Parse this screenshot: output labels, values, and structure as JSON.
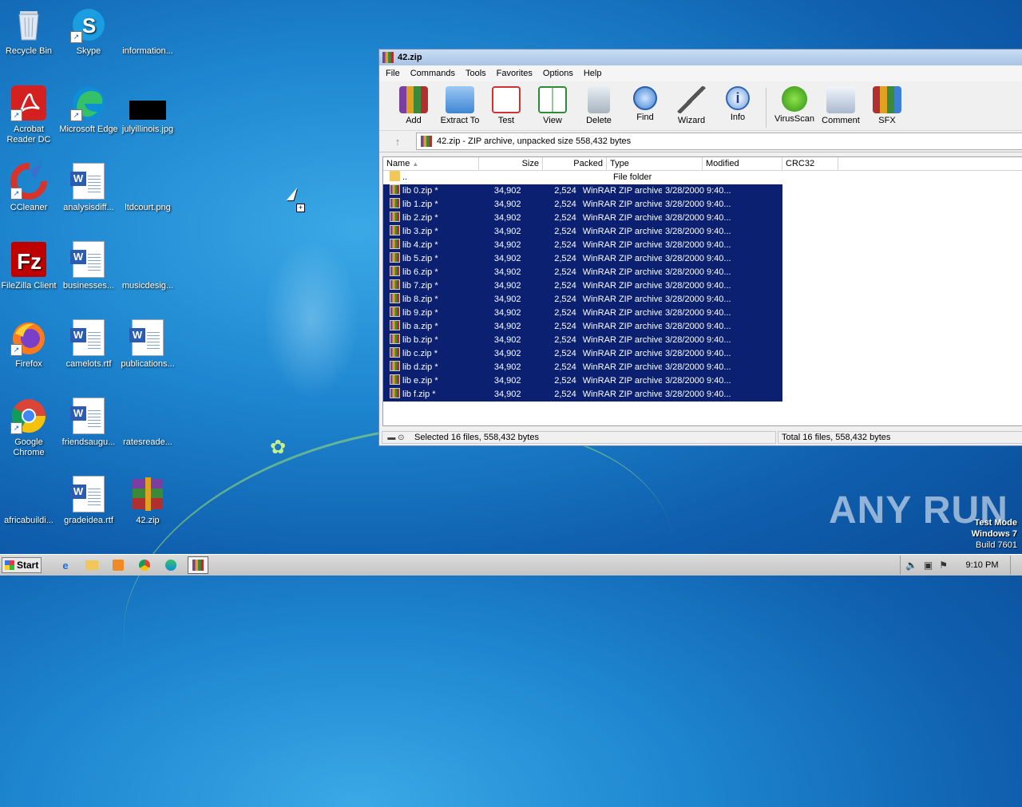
{
  "desktop": {
    "icons": [
      {
        "label": "Recycle Bin"
      },
      {
        "label": "Skype"
      },
      {
        "label": "information..."
      },
      {
        "label": "Acrobat Reader DC"
      },
      {
        "label": "Microsoft Edge"
      },
      {
        "label": "julyillinois.jpg"
      },
      {
        "label": "CCleaner"
      },
      {
        "label": "analysisdiff..."
      },
      {
        "label": "ltdcourt.png"
      },
      {
        "label": "FileZilla Client"
      },
      {
        "label": "businesses..."
      },
      {
        "label": "musicdesig..."
      },
      {
        "label": "Firefox"
      },
      {
        "label": "camelots.rtf"
      },
      {
        "label": "publications..."
      },
      {
        "label": "Google Chrome"
      },
      {
        "label": "friendsaugu..."
      },
      {
        "label": "ratesreade..."
      },
      {
        "label": "africabuildi..."
      },
      {
        "label": "gradeidea.rtf"
      },
      {
        "label": "42.zip"
      }
    ]
  },
  "window": {
    "title": "42.zip",
    "menu": [
      "File",
      "Commands",
      "Tools",
      "Favorites",
      "Options",
      "Help"
    ],
    "toolbar": [
      "Add",
      "Extract To",
      "Test",
      "View",
      "Delete",
      "Find",
      "Wizard",
      "Info",
      "VirusScan",
      "Comment",
      "SFX"
    ],
    "address": "42.zip - ZIP archive, unpacked size 558,432 bytes",
    "up_arrow": "↑",
    "columns": {
      "name": "Name",
      "size": "Size",
      "packed": "Packed",
      "type": "Type",
      "modified": "Modified",
      "crc": "CRC32"
    },
    "parent_row": {
      "name": "..",
      "type": "File folder"
    },
    "rows": [
      {
        "name": "lib 0.zip *",
        "size": "34,902",
        "packed": "2,524",
        "type": "WinRAR ZIP archive",
        "modified": "3/28/2000 9:40..."
      },
      {
        "name": "lib 1.zip *",
        "size": "34,902",
        "packed": "2,524",
        "type": "WinRAR ZIP archive",
        "modified": "3/28/2000 9:40..."
      },
      {
        "name": "lib 2.zip *",
        "size": "34,902",
        "packed": "2,524",
        "type": "WinRAR ZIP archive",
        "modified": "3/28/2000 9:40..."
      },
      {
        "name": "lib 3.zip *",
        "size": "34,902",
        "packed": "2,524",
        "type": "WinRAR ZIP archive",
        "modified": "3/28/2000 9:40..."
      },
      {
        "name": "lib 4.zip *",
        "size": "34,902",
        "packed": "2,524",
        "type": "WinRAR ZIP archive",
        "modified": "3/28/2000 9:40..."
      },
      {
        "name": "lib 5.zip *",
        "size": "34,902",
        "packed": "2,524",
        "type": "WinRAR ZIP archive",
        "modified": "3/28/2000 9:40..."
      },
      {
        "name": "lib 6.zip *",
        "size": "34,902",
        "packed": "2,524",
        "type": "WinRAR ZIP archive",
        "modified": "3/28/2000 9:40..."
      },
      {
        "name": "lib 7.zip *",
        "size": "34,902",
        "packed": "2,524",
        "type": "WinRAR ZIP archive",
        "modified": "3/28/2000 9:40..."
      },
      {
        "name": "lib 8.zip *",
        "size": "34,902",
        "packed": "2,524",
        "type": "WinRAR ZIP archive",
        "modified": "3/28/2000 9:40..."
      },
      {
        "name": "lib 9.zip *",
        "size": "34,902",
        "packed": "2,524",
        "type": "WinRAR ZIP archive",
        "modified": "3/28/2000 9:40..."
      },
      {
        "name": "lib a.zip *",
        "size": "34,902",
        "packed": "2,524",
        "type": "WinRAR ZIP archive",
        "modified": "3/28/2000 9:40..."
      },
      {
        "name": "lib b.zip *",
        "size": "34,902",
        "packed": "2,524",
        "type": "WinRAR ZIP archive",
        "modified": "3/28/2000 9:40..."
      },
      {
        "name": "lib c.zip *",
        "size": "34,902",
        "packed": "2,524",
        "type": "WinRAR ZIP archive",
        "modified": "3/28/2000 9:40..."
      },
      {
        "name": "lib d.zip *",
        "size": "34,902",
        "packed": "2,524",
        "type": "WinRAR ZIP archive",
        "modified": "3/28/2000 9:40..."
      },
      {
        "name": "lib e.zip *",
        "size": "34,902",
        "packed": "2,524",
        "type": "WinRAR ZIP archive",
        "modified": "3/28/2000 9:40..."
      },
      {
        "name": "lib f.zip *",
        "size": "34,902",
        "packed": "2,524",
        "type": "WinRAR ZIP archive",
        "modified": "3/28/2000 9:40..."
      }
    ],
    "status_selected": "Selected 16 files, 558,432 bytes",
    "status_total": "Total 16 files, 558,432 bytes"
  },
  "watermark": {
    "brand": "ANY RUN",
    "line1": "Test Mode",
    "line2": "Windows 7",
    "line3": "Build 7601"
  },
  "taskbar": {
    "start": "Start",
    "clock": "9:10 PM"
  }
}
